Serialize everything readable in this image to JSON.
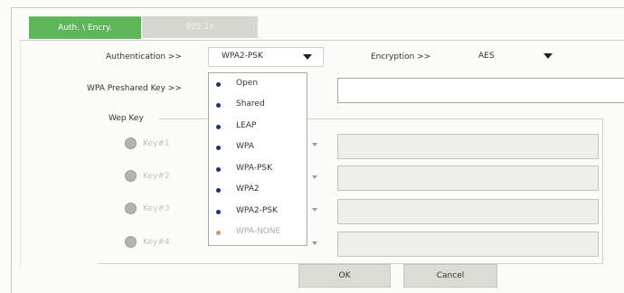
{
  "tabs": [
    {
      "label": "Auth. \\ Encry."
    },
    {
      "label": "802.1x"
    }
  ],
  "authentication": {
    "label": "Authentication >>",
    "value": "WPA2-PSK",
    "options": [
      "Open",
      "Shared",
      "LEAP",
      "WPA",
      "WPA-PSK",
      "WPA2",
      "WPA2-PSK",
      "WPA-NONE"
    ]
  },
  "encryption": {
    "label": "Encryption >>",
    "value": "AES"
  },
  "wpa_key": {
    "label": "WPA Preshared Key >>",
    "value": ""
  },
  "wep": {
    "group_label": "Wep Key",
    "keys": [
      "Key#1",
      "Key#2",
      "Key#3",
      "Key#4"
    ]
  },
  "buttons": {
    "ok": "OK",
    "cancel": "Cancel"
  },
  "colors": {
    "active_tab": "#5fb55a",
    "option_bullet": "#1c2f7a"
  }
}
